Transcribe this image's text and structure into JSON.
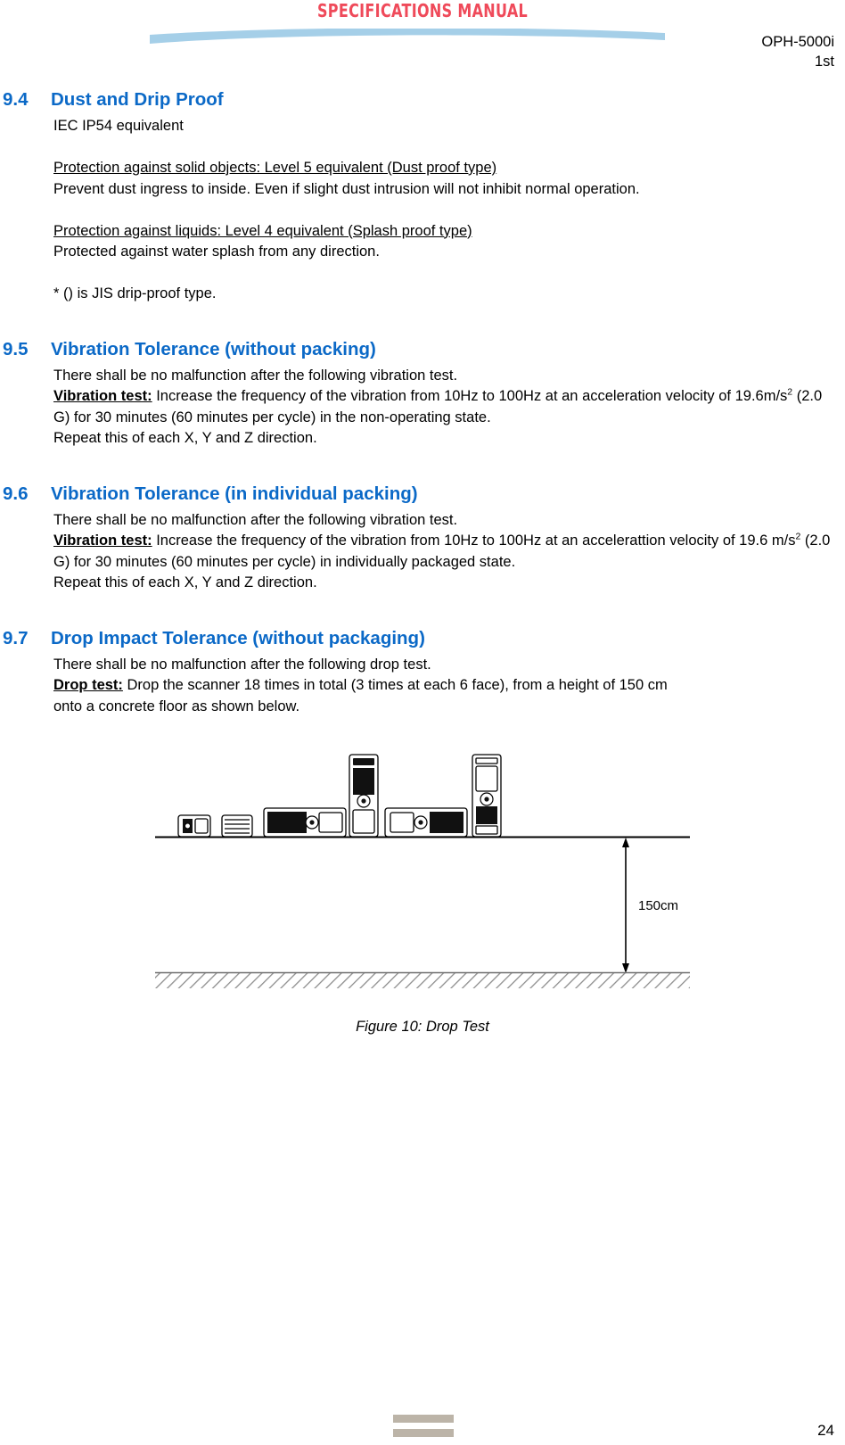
{
  "header": {
    "title": "SPECIFICATIONS MANUAL",
    "model": "OPH-5000i",
    "edition": "1st",
    "title_color": "#ef4a5a",
    "swoosh_color": "#a5cfe8"
  },
  "theme": {
    "heading_color": "#0b69c7",
    "body_color": "#000000",
    "footer_bar_color": "#bcb4a8"
  },
  "sections": [
    {
      "number": "9.4",
      "title": "Dust and Drip Proof",
      "lines": {
        "l1": "IEC IP54 equivalent",
        "l2": "Protection against solid objects: Level 5 equivalent (Dust proof type)",
        "l3": "Prevent dust ingress to inside. Even if slight dust intrusion will not inhibit normal operation.",
        "l4": "Protection against liquids: Level 4 equivalent (Splash proof type)",
        "l5": "Protected against water splash from any direction.",
        "l6": "* () is JIS drip-proof type."
      }
    },
    {
      "number": "9.5",
      "title": "Vibration Tolerance (without packing)",
      "lines": {
        "l1": "There shall be no malfunction after the following vibration test.",
        "label": "Vibration test:",
        "l2a": " Increase the frequency of the vibration from 10Hz to 100Hz at an acceleration",
        "l2b": "velocity of 19.6m/s",
        "l2sup": "2",
        "l2c": " (2.0 G) for 30 minutes (60 minutes per cycle) in the non-operating state.",
        "l3": "Repeat this of each X, Y and Z direction."
      }
    },
    {
      "number": "9.6",
      "title": "Vibration Tolerance (in individual packing)",
      "lines": {
        "l1": "There shall be no malfunction after the following vibration test.",
        "label": "Vibration test:",
        "l2a": " Increase the frequency of the vibration from 10Hz to 100Hz at an accelerattion",
        "l2b": "velocity of 19.6 m/s",
        "l2sup": "2",
        "l2c": " (2.0 G) for 30 minutes (60 minutes per cycle) in individually packaged state.",
        "l3": "Repeat this of each X, Y and Z direction."
      }
    },
    {
      "number": "9.7",
      "title": "Drop Impact Tolerance (without packaging)",
      "lines": {
        "l1": "There shall be no malfunction after the following drop test.",
        "label": "Drop test:",
        "l2a": " Drop the scanner 18 times in total (3 times at each 6 face), from a height of 150 cm",
        "l2b": "onto a concrete floor as shown below."
      }
    }
  ],
  "figure": {
    "caption": "Figure 10: Drop Test",
    "dimension_label": "150cm",
    "drop_height_cm": 150,
    "device_count": 6,
    "floor_label": "concrete floor"
  },
  "footer": {
    "page_number": "24"
  }
}
